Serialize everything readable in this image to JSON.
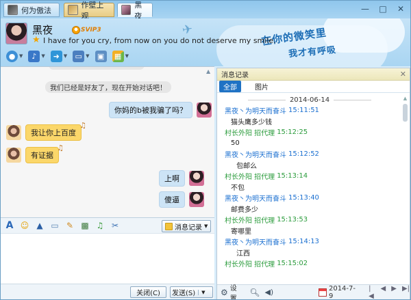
{
  "tabs": [
    {
      "label": "何为傲法",
      "avatar": "dark"
    },
    {
      "label": "作壁上观",
      "avatar": "warm"
    },
    {
      "label": "黑夜",
      "avatar": "pink",
      "active": true
    }
  ],
  "window_controls": {
    "minimize": "—",
    "maximize": "□",
    "close": "✕"
  },
  "contact": {
    "name": "黑夜",
    "badge": "SVIP3",
    "signature": "I have for you cry, from now on you do not deserve my smile."
  },
  "header_decoration": {
    "line1": "在你的微笑里",
    "line2": "我才有呼吸"
  },
  "toolbar": [
    {
      "name": "video",
      "color": "#3c8fd6"
    },
    {
      "name": "audio",
      "color": "#3a78c8"
    },
    {
      "name": "file-transfer",
      "color": "#2f95d8"
    },
    {
      "name": "remote-desktop",
      "color": "#4c7fbf"
    },
    {
      "name": "apps",
      "color": "#e6a024"
    }
  ],
  "chat": {
    "system_notice": "我们已经是好友了，现在开始对话吧！",
    "messages": [
      {
        "from": "me",
        "text": "你妈的b被我骗了吗？"
      },
      {
        "from": "other",
        "text": "我让你上百度"
      },
      {
        "from": "other",
        "text": "有证据"
      },
      {
        "from": "me",
        "text": "上啊"
      },
      {
        "from": "me",
        "text": "傻逼"
      }
    ]
  },
  "compose": {
    "history_button": "消息记录",
    "close_button": "关闭(C)",
    "send_button": "发送(S)"
  },
  "history": {
    "title": "消息记录",
    "tabs": [
      "全部",
      "图片"
    ],
    "date": "2014-06-14",
    "entries": [
      {
        "sender": "黑夜丶为明天而奋斗",
        "time": "15:11:51",
        "text": "猫头鹰多少钱",
        "color": "blue"
      },
      {
        "sender": "村长外阳  招代理",
        "time": "15:12:25",
        "text": "50",
        "color": "green"
      },
      {
        "sender": "黑夜丶为明天而奋斗",
        "time": "15:12:52",
        "text": "包邮么",
        "color": "blue"
      },
      {
        "sender": "村长外阳  招代理",
        "time": "15:13:14",
        "text": "不包",
        "color": "green"
      },
      {
        "sender": "黑夜丶为明天而奋斗",
        "time": "15:13:40",
        "text": "邮费多少",
        "color": "blue"
      },
      {
        "sender": "村长外阳  招代理",
        "time": "15:13:53",
        "text": "寄哪里",
        "color": "green"
      },
      {
        "sender": "黑夜丶为明天而奋斗",
        "time": "15:14:13",
        "text": "江西",
        "color": "blue"
      },
      {
        "sender": "村长外阳  招代理",
        "time": "15:15:02",
        "text": "",
        "color": "green"
      }
    ],
    "footer": {
      "settings_label": "设置",
      "date": "2014-7-9"
    }
  }
}
